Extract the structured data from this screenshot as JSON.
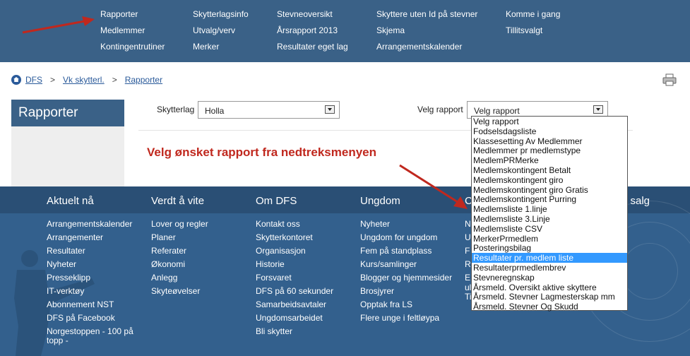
{
  "topnav": {
    "items": [
      "Rapporter",
      "Medlemmer",
      "Kontingentrutiner",
      "Skytterlagsinfo",
      "Utvalg/verv",
      "Merker",
      "Stevneoversikt",
      "Årsrapport 2013",
      "Resultater eget lag",
      "Skyttere uten Id på stevner",
      "Skjema",
      "Arrangementskalender",
      "Komme i gang",
      "Tillitsvalgt"
    ]
  },
  "breadcrumb": [
    "DFS",
    "Vk skytterl.",
    "Rapporter"
  ],
  "sidebar": {
    "title": "Rapporter"
  },
  "form": {
    "skytterlag_label": "Skytterlag",
    "skytterlag_value": "Holla",
    "rapport_label": "Velg rapport",
    "rapport_value": "Velg rapport"
  },
  "instruction": "Velg ønsket rapport fra nedtreksmenyen",
  "dropdown": {
    "options": [
      "Velg rapport",
      "Fodselsdagsliste",
      "Klassesetting Av Medlemmer",
      "Medlemmer pr medlemstype",
      "MedlemPRMerke",
      "Medlemskontingent Betalt",
      "Medlemskontingent giro",
      "Medlemskontingent giro Gratis",
      "Medlemskontingent Purring",
      "Medlemsliste 1.linje",
      "Medlemsliste 3.Linje",
      "Medlemsliste CSV",
      "MerkerPrmedlem",
      "Posteringsbilag",
      "Resultater pr. medlem liste",
      "Resultaterprmedlembrev",
      "Stevneregnskap",
      "Årsmeld. Oversikt aktive skyttere",
      "Årsmeld. Stevner Lagmesterskap mm",
      "Årsmeld. Stevner Og Skudd"
    ],
    "highlighted_index": 14
  },
  "footer": {
    "headings": [
      "Aktuelt nå",
      "Verdt å vite",
      "Om DFS",
      "Ungdom",
      "C",
      "g salg"
    ],
    "col1": [
      "Arrangementskalender",
      "Arrangementer",
      "Resultater",
      "Nyheter",
      "Presseklipp",
      "IT-verktøy",
      "Abonnement NST",
      "DFS på Facebook",
      "Norgestoppen - 100 på",
      "topp -"
    ],
    "col2": [
      "Lover og regler",
      "Planer",
      "Referater",
      "Økonomi",
      "Anlegg",
      "Skyteøvelser"
    ],
    "col3": [
      "Kontakt oss",
      "Skytterkontoret",
      "Organisasjon",
      "Historie",
      "Forsvaret",
      "DFS på 60 sekunder",
      "Samarbeidsavtaler",
      "Ungdomsarbeidet",
      "Bli skytter"
    ],
    "col4": [
      "Nyheter",
      "Ungdom for ungdom",
      "Fem på standplass",
      "Kurs/samlinger",
      "Blogger og hjemmesider",
      "Brosjyrer",
      "Opptak fra LS",
      "Flere unge i feltløypa"
    ],
    "col5": [
      "N",
      "U",
      "F",
      "R",
      "E",
      "ul",
      "Ti"
    ]
  },
  "colors": {
    "nav": "#3a6187",
    "footer": "#33608d",
    "accent": "#c0281e",
    "highlight": "#3399ff"
  }
}
